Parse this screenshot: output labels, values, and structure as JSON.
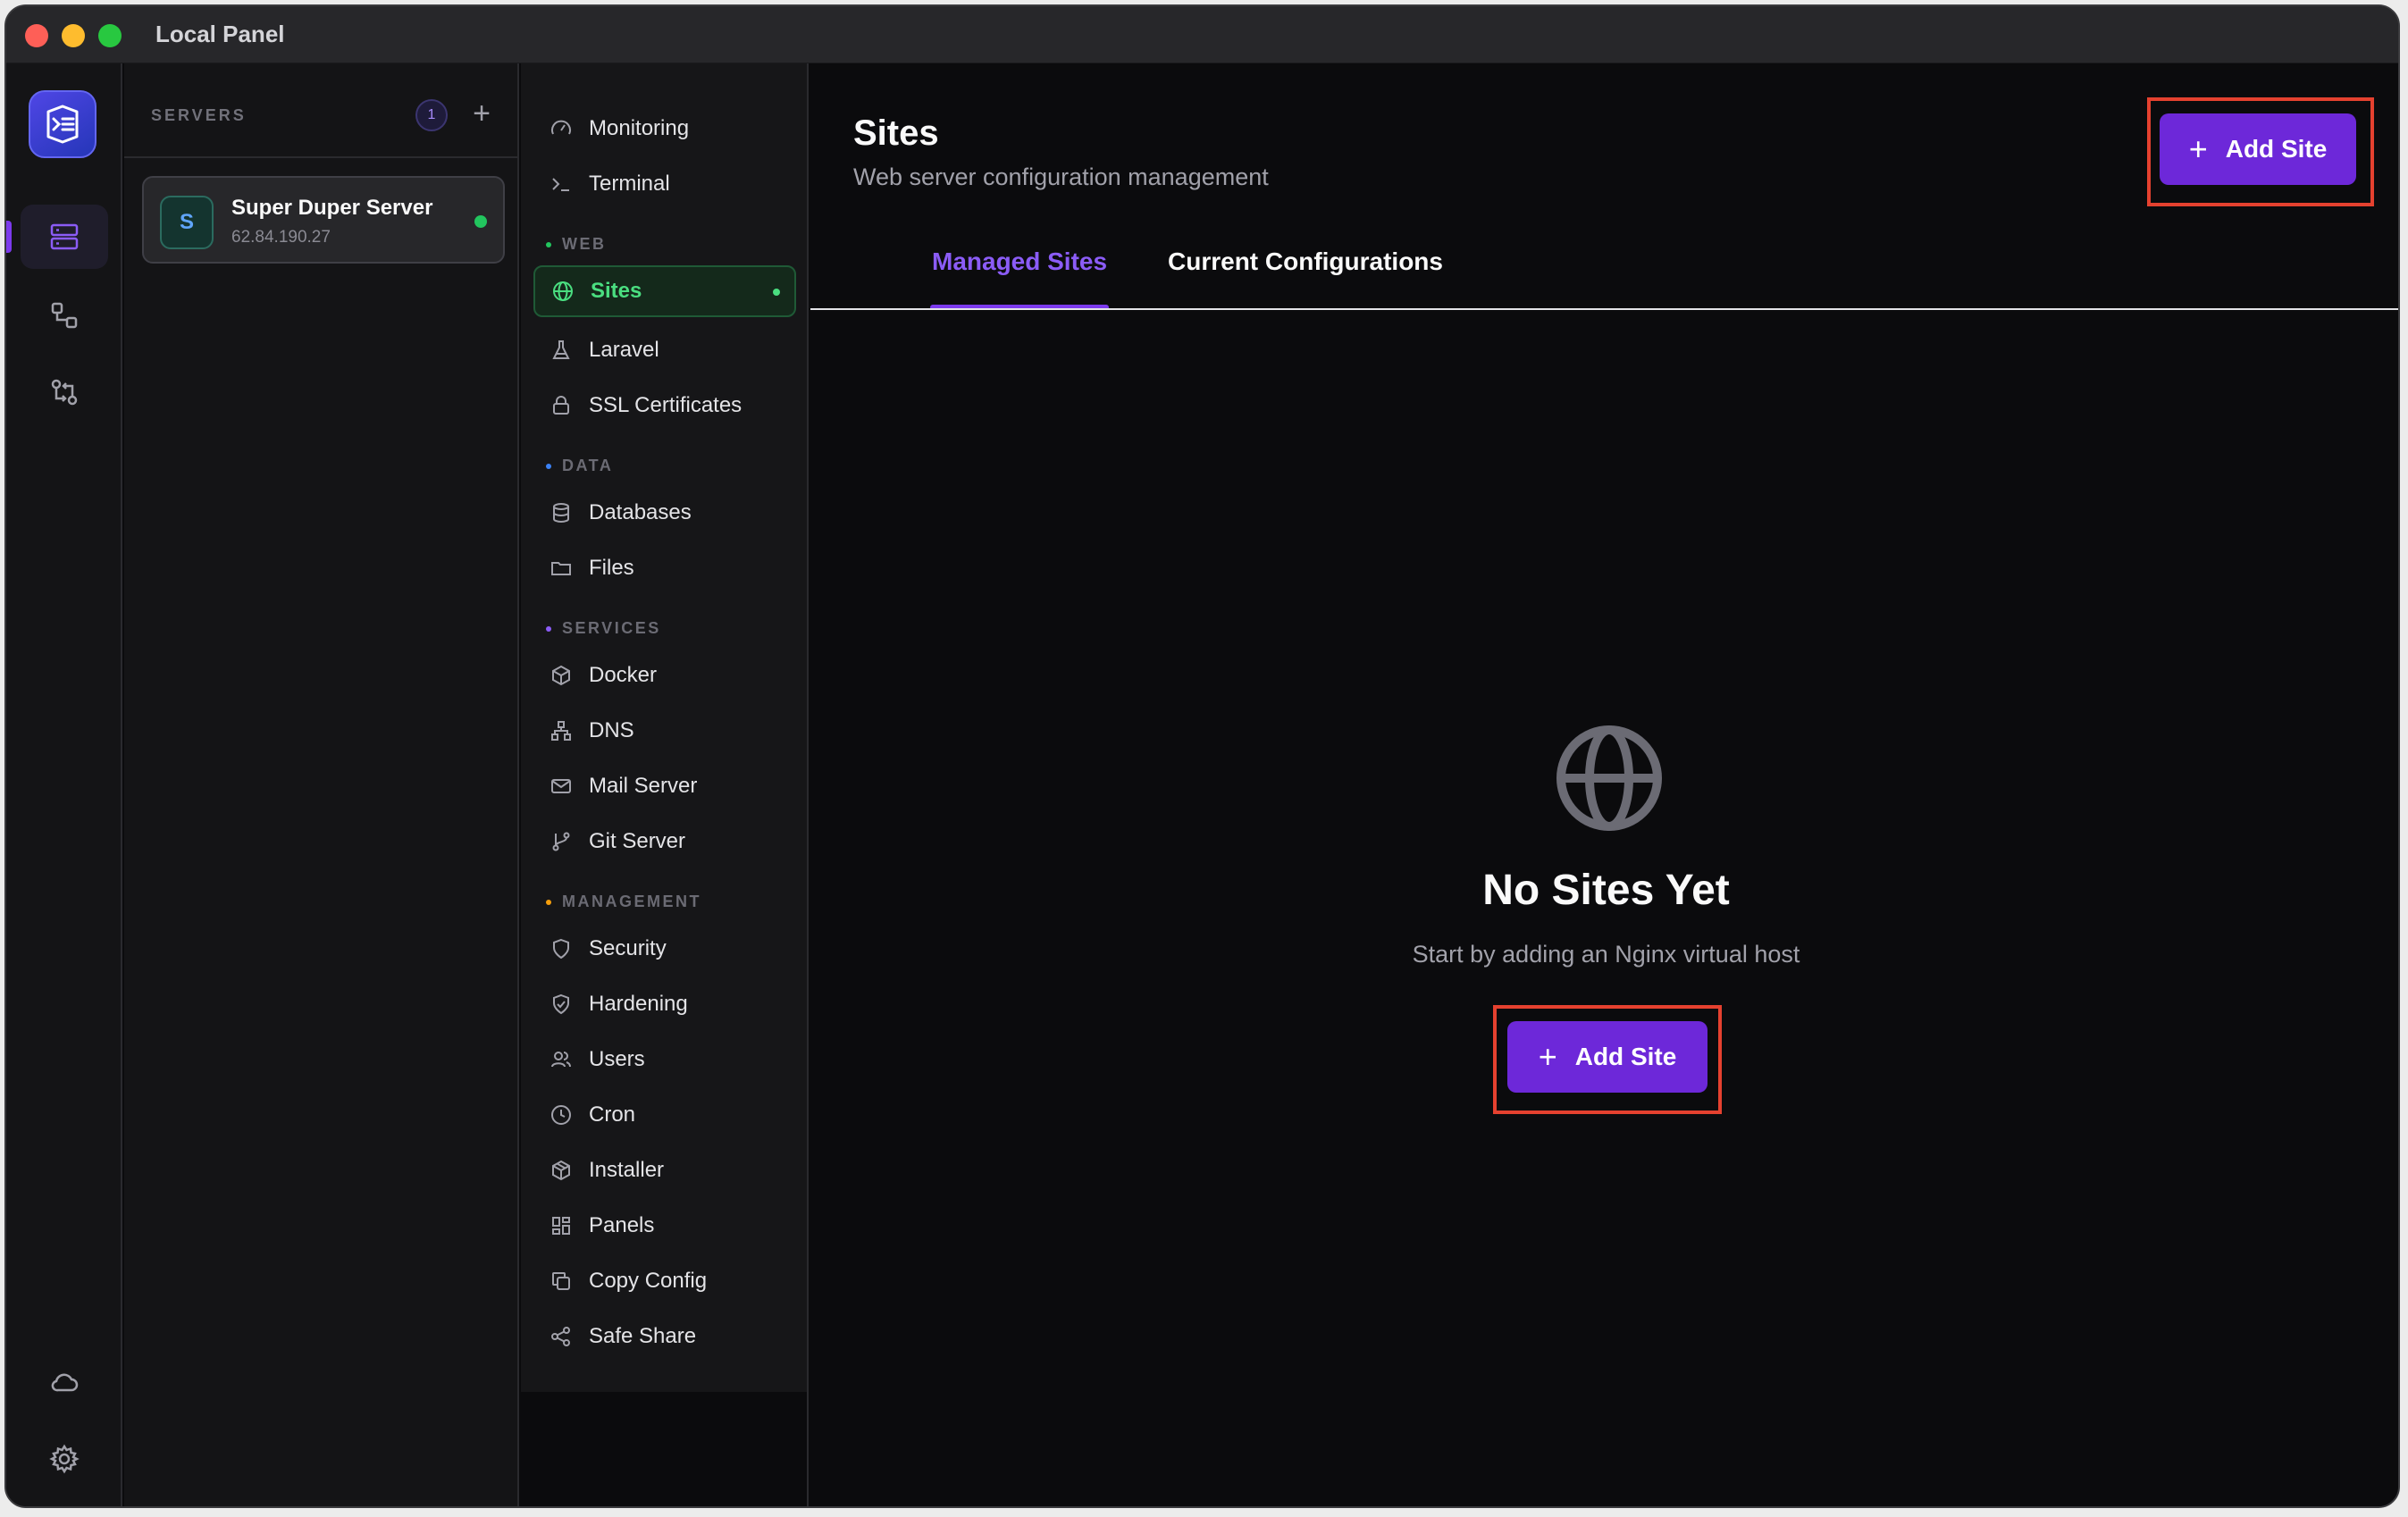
{
  "window": {
    "title": "Local Panel"
  },
  "servers": {
    "header": "SERVERS",
    "count": "1",
    "add_symbol": "+",
    "items": [
      {
        "initial": "S",
        "name": "Super Duper Server",
        "ip": "62.84.190.27",
        "status": "online"
      }
    ]
  },
  "nav": {
    "top_items": [
      {
        "label": "Monitoring",
        "icon": "gauge-icon"
      },
      {
        "label": "Terminal",
        "icon": "terminal-icon"
      }
    ],
    "sections": [
      {
        "title": "WEB",
        "color": "#22c55e",
        "items": [
          {
            "label": "Sites",
            "icon": "globe-icon",
            "active": true
          },
          {
            "label": "Laravel",
            "icon": "flask-icon"
          },
          {
            "label": "SSL Certificates",
            "icon": "lock-icon"
          }
        ]
      },
      {
        "title": "DATA",
        "color": "#3b82f6",
        "items": [
          {
            "label": "Databases",
            "icon": "database-icon"
          },
          {
            "label": "Files",
            "icon": "folder-icon"
          }
        ]
      },
      {
        "title": "SERVICES",
        "color": "#8b5cf6",
        "items": [
          {
            "label": "Docker",
            "icon": "box-icon"
          },
          {
            "label": "DNS",
            "icon": "network-icon"
          },
          {
            "label": "Mail Server",
            "icon": "mail-icon"
          },
          {
            "label": "Git Server",
            "icon": "git-branch-icon"
          }
        ]
      },
      {
        "title": "MANAGEMENT",
        "color": "#f59e0b",
        "items": [
          {
            "label": "Security",
            "icon": "shield-icon"
          },
          {
            "label": "Hardening",
            "icon": "shield-check-icon"
          },
          {
            "label": "Users",
            "icon": "users-icon"
          },
          {
            "label": "Cron",
            "icon": "clock-icon"
          },
          {
            "label": "Installer",
            "icon": "package-icon"
          },
          {
            "label": "Panels",
            "icon": "grid-icon"
          },
          {
            "label": "Copy Config",
            "icon": "copy-icon"
          },
          {
            "label": "Safe Share",
            "icon": "share-icon"
          }
        ]
      }
    ]
  },
  "main": {
    "title": "Sites",
    "subtitle": "Web server configuration management",
    "add_button_label": "Add Site",
    "tabs": [
      {
        "label": "Managed Sites",
        "active": true
      },
      {
        "label": "Current Configurations",
        "active": false
      }
    ],
    "empty": {
      "title": "No Sites Yet",
      "subtitle": "Start by adding an Nginx virtual host",
      "button_label": "Add Site"
    }
  },
  "colors": {
    "accent": "#6d28d9",
    "active_green": "#4ade80",
    "highlight": "#e5412f"
  }
}
